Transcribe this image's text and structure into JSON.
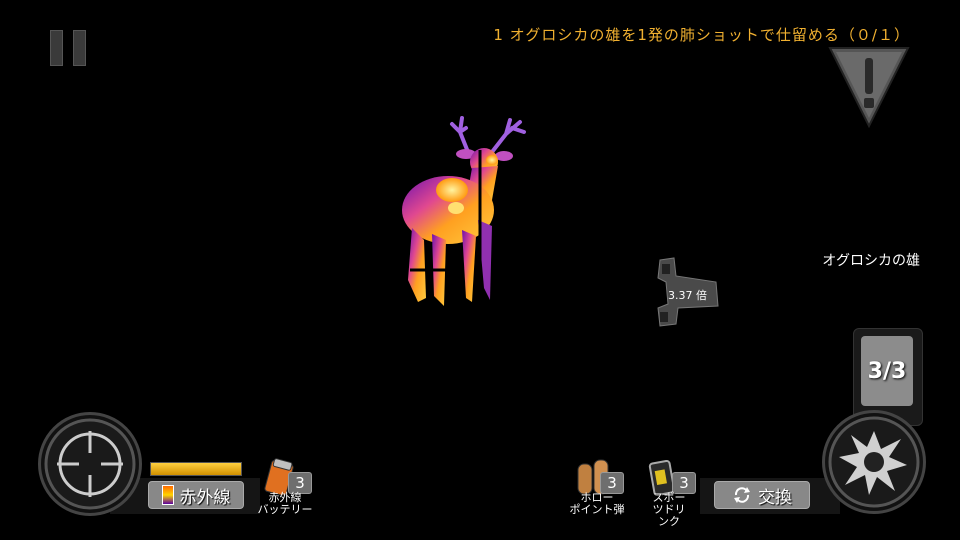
{
  "objective": {
    "text": "1 オグロシカの雄を1発の肺ショットで仕留める（０/１）"
  },
  "target": {
    "label": "オグロシカの雄"
  },
  "scope": {
    "zoom_label": "3.37 倍"
  },
  "ammo": {
    "count_label": "3/3"
  },
  "thermal": {
    "button_label": "赤外線",
    "battery_level": 1.0
  },
  "items": [
    {
      "name": "赤外線\nバッテリー",
      "count": "3",
      "icon": "battery-icon"
    },
    {
      "name": "ホロー\nポイント弾",
      "count": "3",
      "icon": "hollow-point-bullets-icon"
    },
    {
      "name": "スポー\nツドリ\nンク",
      "count": "3",
      "icon": "sports-drink-icon"
    }
  ],
  "swap": {
    "label": "交換"
  },
  "colors": {
    "objective": "#f0b030",
    "thermal_hot": "#ffd500",
    "thermal_cold": "#5a00a0"
  }
}
